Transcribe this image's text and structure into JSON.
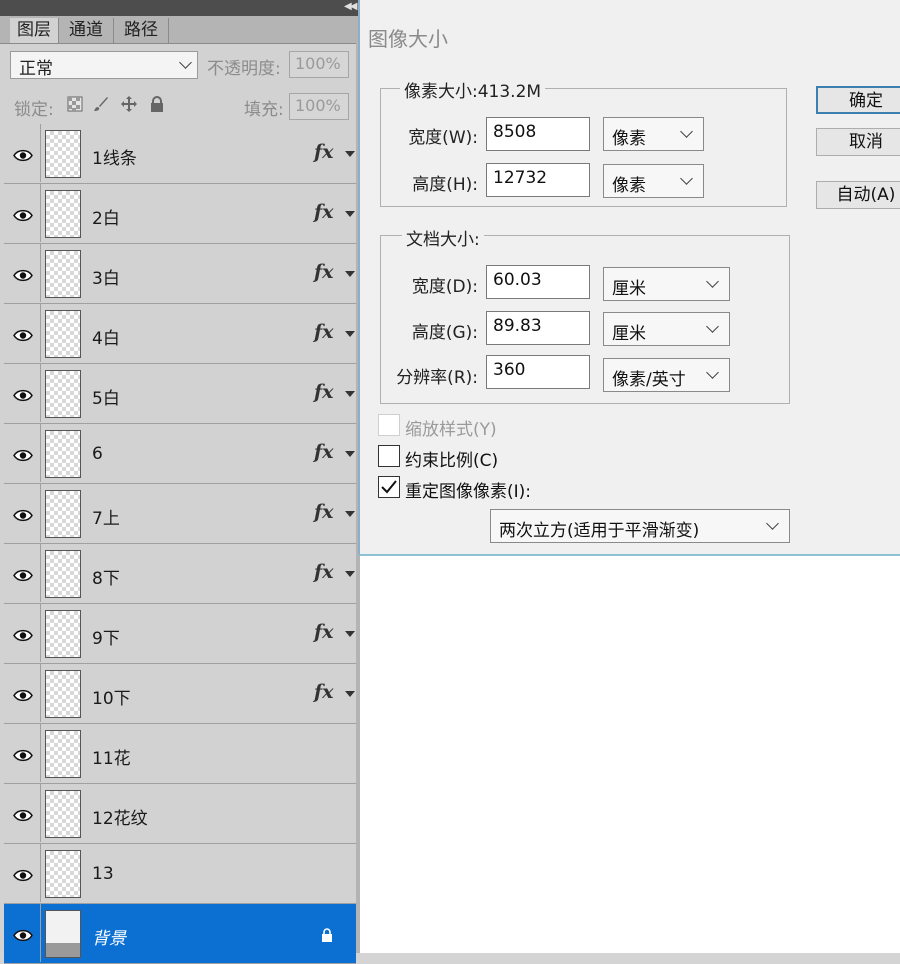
{
  "layers_panel": {
    "tabs": [
      "图层",
      "通道",
      "路径"
    ],
    "active_tab": 0,
    "blend_mode": "正常",
    "opacity_label": "不透明度:",
    "opacity_value": "100%",
    "lock_label": "锁定:",
    "fill_label": "填充:",
    "fill_value": "100%",
    "layers": [
      {
        "name": "1线条",
        "fx": "fx"
      },
      {
        "name": "2白",
        "fx": "fx"
      },
      {
        "name": "3白",
        "fx": "fx"
      },
      {
        "name": "4白",
        "fx": "fx"
      },
      {
        "name": "5白",
        "fx": "fx"
      },
      {
        "name": "6",
        "fx": "fx"
      },
      {
        "name": "7上",
        "fx": "fx"
      },
      {
        "name": "8下",
        "fx": "fx"
      },
      {
        "name": "9下",
        "fx": "fx"
      },
      {
        "name": "10下",
        "fx": "fx"
      },
      {
        "name": "11花",
        "fx": ""
      },
      {
        "name": "12花纹",
        "fx": ""
      },
      {
        "name": "13",
        "fx": ""
      },
      {
        "name": "背景",
        "fx": "",
        "selected": true,
        "locked": true
      }
    ]
  },
  "dialog": {
    "title": "图像大小",
    "pixel_dimensions": {
      "label": "像素大小:413.2M",
      "width_label": "宽度(W):",
      "width_value": "8508",
      "width_unit": "像素",
      "height_label": "高度(H):",
      "height_value": "12732",
      "height_unit": "像素"
    },
    "document_size": {
      "label": "文档大小:",
      "width_label": "宽度(D):",
      "width_value": "60.03",
      "width_unit": "厘米",
      "height_label": "高度(G):",
      "height_value": "89.83",
      "height_unit": "厘米",
      "resolution_label": "分辨率(R):",
      "resolution_value": "360",
      "resolution_unit": "像素/英寸"
    },
    "scale_styles": {
      "label": "缩放样式(Y)",
      "checked": false,
      "enabled": false
    },
    "constrain": {
      "label": "约束比例(C)",
      "checked": false
    },
    "resample": {
      "label": "重定图像像素(I):",
      "checked": true
    },
    "resample_method": "两次立方(适用于平滑渐变)",
    "buttons": {
      "ok": "确定",
      "cancel": "取消",
      "auto": "自动(A)"
    }
  }
}
